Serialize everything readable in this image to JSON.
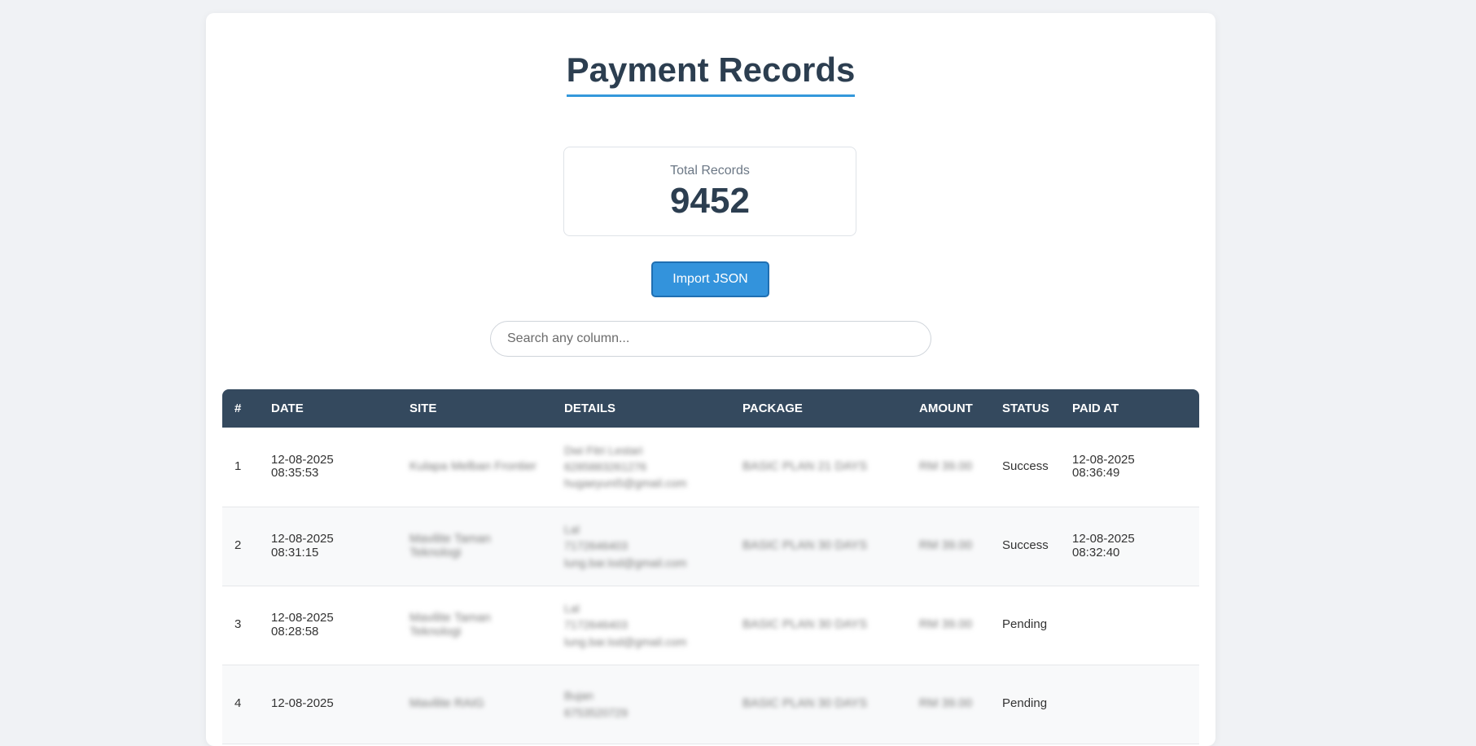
{
  "header": {
    "title": "Payment Records"
  },
  "stats": {
    "total_label": "Total Records",
    "total_value": "9452"
  },
  "actions": {
    "import_label": "Import JSON"
  },
  "search": {
    "placeholder": "Search any column..."
  },
  "table": {
    "columns": [
      "#",
      "DATE",
      "SITE",
      "DETAILS",
      "PACKAGE",
      "AMOUNT",
      "STATUS",
      "PAID AT"
    ],
    "rows": [
      {
        "num": "1",
        "date_line1": "12-08-2025",
        "date_line2": "08:35:53",
        "site": "Kulapa Melban Frontier",
        "details": [
          "Dwi Fitri Lestari",
          "6285883261276",
          "hugaeyuni5@gmail.com"
        ],
        "package": "BASIC PLAN 21 DAYS",
        "amount": "RM 39.00",
        "status": "Success",
        "paid_line1": "12-08-2025",
        "paid_line2": "08:36:49"
      },
      {
        "num": "2",
        "date_line1": "12-08-2025",
        "date_line2": "08:31:15",
        "site": "Mavilite Taman",
        "site_line2": "Teknologi",
        "details": [
          "Lal",
          "7172646403",
          "lung.bar.lod@gmail.com"
        ],
        "package": "BASIC PLAN 30 DAYS",
        "amount": "RM 39.00",
        "status": "Success",
        "paid_line1": "12-08-2025",
        "paid_line2": "08:32:40"
      },
      {
        "num": "3",
        "date_line1": "12-08-2025",
        "date_line2": "08:28:58",
        "site": "Mavilite Taman",
        "site_line2": "Teknologi",
        "details": [
          "Lal",
          "7172646403",
          "lung.bar.lod@gmail.com"
        ],
        "package": "BASIC PLAN 30 DAYS",
        "amount": "RM 39.00",
        "status": "Pending",
        "paid_line1": "",
        "paid_line2": ""
      },
      {
        "num": "4",
        "date_line1": "12-08-2025",
        "date_line2": "",
        "site": "Mavilite RAIG",
        "site_line2": "",
        "details": [
          "Bujan",
          "6753520729",
          ""
        ],
        "package": "BASIC PLAN 30 DAYS",
        "amount": "RM 39.00",
        "status": "Pending",
        "paid_line1": "",
        "paid_line2": ""
      }
    ]
  },
  "colors": {
    "header_bg": "#34495e",
    "accent": "#3498db",
    "button_bg": "#3393dc",
    "page_bg": "#f0f2f5"
  }
}
